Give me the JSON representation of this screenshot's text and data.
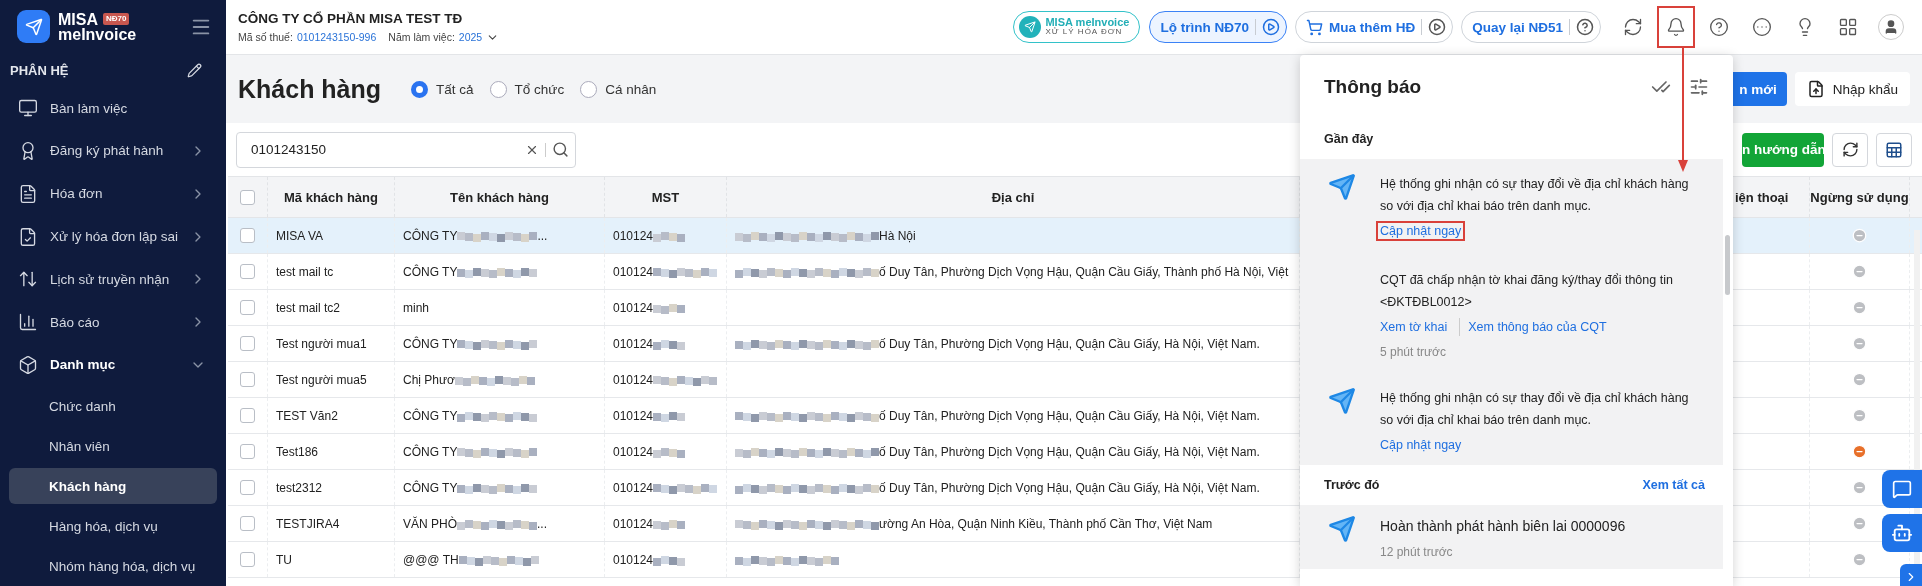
{
  "brand": {
    "top": "MISA",
    "bottom": "meInvoice",
    "badge": "NĐ70"
  },
  "sidebar": {
    "heading": "PHÂN HỆ",
    "items": [
      {
        "label": "Bàn làm việc",
        "kind": "link",
        "expanded": false
      },
      {
        "label": "Đăng ký phát hành",
        "kind": "group",
        "expanded": false
      },
      {
        "label": "Hóa đơn",
        "kind": "group",
        "expanded": false
      },
      {
        "label": "Xử lý hóa đơn lập sai",
        "kind": "group",
        "expanded": false
      },
      {
        "label": "Lịch sử truyền nhận",
        "kind": "group",
        "expanded": false
      },
      {
        "label": "Báo cáo",
        "kind": "group",
        "expanded": false
      },
      {
        "label": "Danh mục",
        "kind": "group",
        "expanded": true,
        "children": [
          {
            "label": "Chức danh",
            "selected": false
          },
          {
            "label": "Nhân viên",
            "selected": false
          },
          {
            "label": "Khách hàng",
            "selected": true
          },
          {
            "label": "Hàng hóa, dịch vụ",
            "selected": false
          },
          {
            "label": "Nhóm hàng hóa, dịch vụ",
            "selected": false
          }
        ]
      }
    ]
  },
  "header": {
    "company": "CÔNG TY CỔ PHẦN MISA TEST TĐ",
    "tax_label": "Mã số thuế:",
    "tax_code": "0101243150-996",
    "year_label": "Năm làm việc:",
    "year": "2025",
    "promo": {
      "brand_a": "MISA",
      "brand_b": "meInvoice",
      "subtitle": "XỬ LÝ HÓA ĐƠN"
    },
    "pills": [
      {
        "label": "Lộ trình NĐ70",
        "kind": "primary"
      },
      {
        "label": "Mua thêm HĐ",
        "kind": "cart"
      },
      {
        "label": "Quay lại NĐ51",
        "kind": "help"
      }
    ],
    "tools": [
      {
        "kind": "refresh",
        "highlighted": false
      },
      {
        "kind": "bell",
        "highlighted": true
      },
      {
        "kind": "help",
        "highlighted": false
      },
      {
        "kind": "more",
        "highlighted": false
      },
      {
        "kind": "guide",
        "highlighted": false
      },
      {
        "kind": "apps",
        "highlighted": false
      },
      {
        "kind": "avatar",
        "highlighted": false
      }
    ]
  },
  "page": {
    "title": "Khách hàng",
    "filters": [
      {
        "label": "Tất cả",
        "selected": true
      },
      {
        "label": "Tổ chức",
        "selected": false
      },
      {
        "label": "Cá nhân",
        "selected": false
      }
    ],
    "add_button": "n mới",
    "import_button": "Nhập khẩu",
    "search": {
      "value": "0101243150"
    },
    "guide_button": "n hướng dẫn"
  },
  "table": {
    "all_checked": false,
    "columns": [
      "Mã khách hàng",
      "Tên khách hàng",
      "MST",
      "Địa chỉ",
      "iện thoại",
      "Ngừng sử dụng"
    ],
    "rows": [
      {
        "selected": true,
        "checked": false,
        "code": "MISA VA",
        "name": {
          "text": "CÔNG TY",
          "redacted_before": false,
          "redacted_after": true,
          "tail": "..."
        },
        "tax": {
          "text": "010124",
          "redacted_before": false,
          "redacted_after": true
        },
        "address": {
          "text": "Hà Nội",
          "redacted_before": true,
          "redacted_after": false
        },
        "stopped": false
      },
      {
        "selected": false,
        "checked": false,
        "code": "test mail tc",
        "name": {
          "text": "CÔNG TY",
          "redacted_before": false,
          "redacted_after": true
        },
        "tax": {
          "text": "010124",
          "redacted_before": false,
          "redacted_after": true
        },
        "address": {
          "text": "ố Duy Tân, Phường Dịch Vọng Hậu, Quận Cầu Giấy, Thành phố Hà Nội, Việt",
          "redacted_before": true,
          "redacted_after": false
        },
        "stopped": false
      },
      {
        "selected": false,
        "checked": false,
        "code": "test mail tc2",
        "name": {
          "text": "minh",
          "redacted_before": false,
          "redacted_after": false
        },
        "tax": {
          "text": "010124",
          "redacted_before": false,
          "redacted_after": true
        },
        "address": {
          "redacted_before": false,
          "redacted_after": false
        },
        "stopped": false
      },
      {
        "selected": false,
        "checked": false,
        "code": "Test người mua1",
        "name": {
          "text": "CÔNG TY",
          "redacted_before": false,
          "redacted_after": true
        },
        "tax": {
          "text": "010124",
          "redacted_before": false,
          "redacted_after": true
        },
        "address": {
          "text": "ố Duy Tân, Phường Dịch Vọng Hậu, Quận Cầu Giấy, Hà Nội, Việt Nam.",
          "redacted_before": true,
          "redacted_after": false
        },
        "stopped": false
      },
      {
        "selected": false,
        "checked": false,
        "code": "Test người mua5",
        "name": {
          "text": "Chị Phươ",
          "redacted_before": false,
          "redacted_after": true
        },
        "tax": {
          "text": "010124",
          "redacted_before": false,
          "redacted_after": true
        },
        "address": {
          "redacted_before": false,
          "redacted_after": false
        },
        "stopped": false
      },
      {
        "selected": false,
        "checked": false,
        "code": "TEST Văn2",
        "name": {
          "text": "CÔNG TY",
          "redacted_before": false,
          "redacted_after": true
        },
        "tax": {
          "text": "010124",
          "redacted_before": false,
          "redacted_after": true
        },
        "address": {
          "text": "ố Duy Tân, Phường Dịch Vọng Hậu, Quận Cầu Giấy, Hà Nội, Việt Nam.",
          "redacted_before": true,
          "redacted_after": false
        },
        "stopped": false
      },
      {
        "selected": false,
        "checked": false,
        "code": "Test186",
        "name": {
          "text": "CÔNG TY",
          "redacted_before": false,
          "redacted_after": true
        },
        "tax": {
          "text": "010124",
          "redacted_before": false,
          "redacted_after": true
        },
        "address": {
          "text": "ố Duy Tân, Phường Dịch Vọng Hậu, Quận Cầu Giấy, Hà Nội, Việt Nam.",
          "redacted_before": true,
          "redacted_after": false
        },
        "stopped": true
      },
      {
        "selected": false,
        "checked": false,
        "code": "test2312",
        "name": {
          "text": "CÔNG TY",
          "redacted_before": false,
          "redacted_after": true
        },
        "tax": {
          "text": "010124",
          "redacted_before": false,
          "redacted_after": true
        },
        "address": {
          "text": "ố Duy Tân, Phường Dịch Vọng Hậu, Quận Cầu Giấy, Hà Nội, Việt Nam.",
          "redacted_before": true,
          "redacted_after": false
        },
        "stopped": false
      },
      {
        "selected": false,
        "checked": false,
        "code": "TESTJIRA4",
        "name": {
          "text": "VĂN PHÒ",
          "redacted_before": false,
          "redacted_after": true,
          "tail": "..."
        },
        "tax": {
          "text": "010124",
          "redacted_before": false,
          "redacted_after": true
        },
        "address": {
          "text": "ường An Hòa, Quận Ninh Kiều, Thành phố Cần Thơ, Việt Nam",
          "redacted_before": true,
          "redacted_after": false
        },
        "stopped": false
      },
      {
        "selected": false,
        "checked": false,
        "code": "TU",
        "name": {
          "text": "@@@ TH",
          "redacted_before": false,
          "redacted_after": true
        },
        "tax": {
          "text": "010124",
          "redacted_before": false,
          "redacted_after": true
        },
        "address": {
          "redacted_before": true,
          "redacted_after": false
        },
        "stopped": false
      }
    ]
  },
  "notifications": {
    "title": "Thông báo",
    "recent_label": "Gần đây",
    "items": [
      {
        "kind": "system",
        "text": "Hệ thống ghi nhận có sự thay đổi về địa chỉ khách hàng so với địa chỉ khai báo trên danh mục.",
        "links": [
          {
            "label": "Cập nhật ngay",
            "highlighted": true
          }
        ]
      },
      {
        "kind": "plain",
        "text": "CQT đã chấp nhận tờ khai đăng ký/thay đổi thông tin <ĐKTĐBL0012>",
        "links": [
          {
            "label": "Xem tờ khai",
            "highlighted": false
          },
          {
            "label": "Xem thông báo của CQT",
            "highlighted": false
          }
        ],
        "time": "5 phút trước"
      },
      {
        "kind": "system",
        "text": "Hệ thống ghi nhận có sự thay đổi về địa chỉ khách hàng so với địa chỉ khai báo trên danh mục.",
        "links": [
          {
            "label": "Cập nhật ngay",
            "highlighted": false
          }
        ]
      }
    ],
    "earlier_label": "Trước đó",
    "view_all": "Xem tất cả",
    "earlier_items": [
      {
        "kind": "system",
        "text": "Hoàn thành phát hành biên lai 0000096",
        "time": "12 phút trước"
      }
    ]
  }
}
